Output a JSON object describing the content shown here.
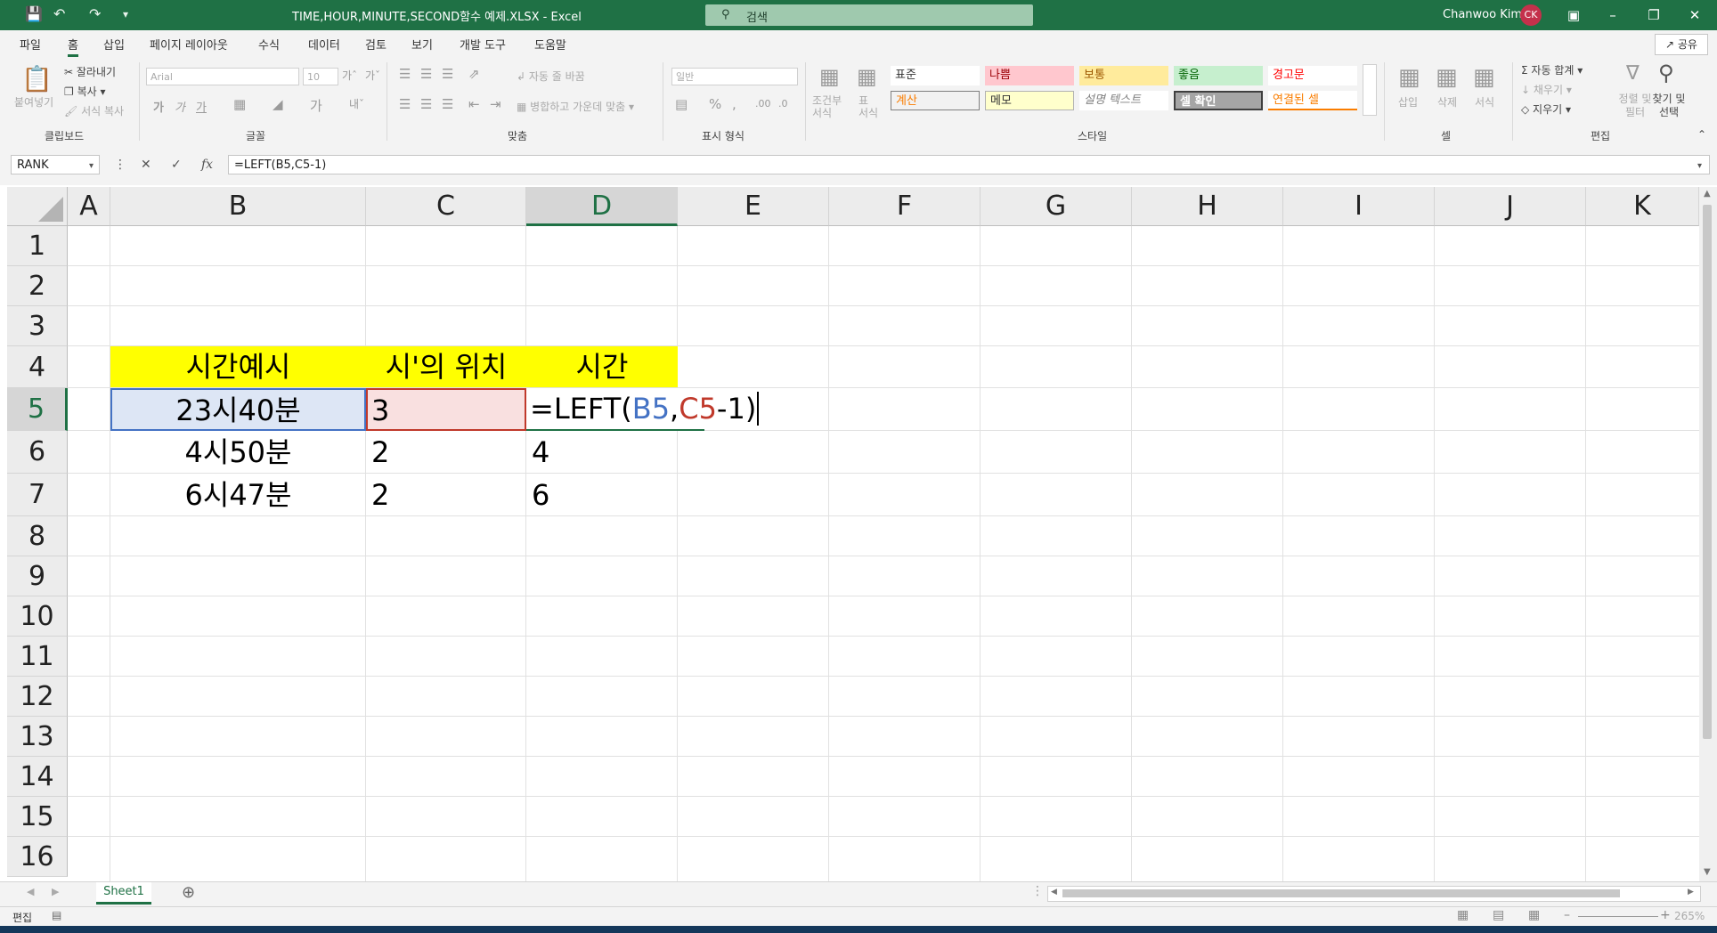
{
  "title_bar": {
    "doc_title": "TIME,HOUR,MINUTE,SECOND함수 예제.XLSX  -  Excel",
    "search_placeholder": "검색",
    "user_name": "Chanwoo Kim",
    "user_initials": "CK",
    "accent": "#1f7145",
    "avatar_color": "#c4314b"
  },
  "ribbon_tabs": [
    "파일",
    "홈",
    "삽입",
    "페이지 레이아웃",
    "수식",
    "데이터",
    "검토",
    "보기",
    "개발 도구",
    "도움말"
  ],
  "share_label": "공유",
  "ribbon": {
    "clipboard": {
      "paste": "붙여넣기",
      "cut": "잘라내기",
      "copy": "복사",
      "format_painter": "서식 복사",
      "group": "클립보드"
    },
    "font": {
      "font_name": "Arial",
      "font_size": "10",
      "group": "글꼴"
    },
    "alignment": {
      "wrap": "자동 줄 바꿈",
      "merge": "병합하고 가운데 맞춤",
      "group": "맞춤"
    },
    "number": {
      "format": "일반",
      "group": "표시 형식"
    },
    "styles": {
      "cond_format": "조건부 서식",
      "table_format": "표 서식",
      "cells": [
        {
          "label": "표준",
          "bg": "#ffffff",
          "fg": "#333333"
        },
        {
          "label": "나쁨",
          "bg": "#ffc7ce",
          "fg": "#9c0006"
        },
        {
          "label": "보통",
          "bg": "#ffeb9c",
          "fg": "#9c5700"
        },
        {
          "label": "좋음",
          "bg": "#c6efce",
          "fg": "#006100"
        },
        {
          "label": "경고문",
          "bg": "#ffffff",
          "fg": "#ff0000"
        },
        {
          "label": "계산",
          "bg": "#f2f2f2",
          "fg": "#fa7d00"
        },
        {
          "label": "메모",
          "bg": "#ffffcc",
          "fg": "#333333"
        },
        {
          "label": "설명 텍스트",
          "bg": "#ffffff",
          "fg": "#7f7f7f"
        },
        {
          "label": "셀 확인",
          "bg": "#a5a5a5",
          "fg": "#ffffff"
        },
        {
          "label": "연결된 셀",
          "bg": "#ffffff",
          "fg": "#fa7d00"
        }
      ],
      "group": "스타일"
    },
    "cells": {
      "insert": "삽입",
      "delete": "삭제",
      "format": "서식",
      "group": "셀"
    },
    "editing": {
      "autosum": "자동 합계",
      "fill": "채우기",
      "clear": "지우기",
      "sort_filter": "정렬 및 필터",
      "find_select": "찾기 및 선택",
      "group": "편집"
    }
  },
  "formula_bar": {
    "name_box": "RANK",
    "formula": "=LEFT(B5,C5-1)"
  },
  "columns": [
    "A",
    "B",
    "C",
    "D",
    "E",
    "F",
    "G",
    "H",
    "I",
    "J",
    "K"
  ],
  "rows": [
    "1",
    "2",
    "3",
    "4",
    "5",
    "6",
    "7",
    "8",
    "9",
    "10",
    "11",
    "12",
    "13",
    "14",
    "15",
    "16"
  ],
  "cells": {
    "B4": "시간예시",
    "C4": "시'의 위치",
    "D4": "시간",
    "B5": "23시40분",
    "C5": "3",
    "B6": "4시50분",
    "C6": "2",
    "D6": "4",
    "B7": "6시47분",
    "C7": "2",
    "D7": "6"
  },
  "edit_formula": {
    "prefix": "=LEFT(",
    "ref1": "B5",
    "comma": ",",
    "ref2": "C5",
    "suffix": "-1)"
  },
  "colors": {
    "header_fill": "#ffff00",
    "ref1": "#4472c4",
    "ref2": "#c0392b"
  },
  "sheet_tab": "Sheet1",
  "status": {
    "mode": "편집",
    "zoom": "265%"
  }
}
